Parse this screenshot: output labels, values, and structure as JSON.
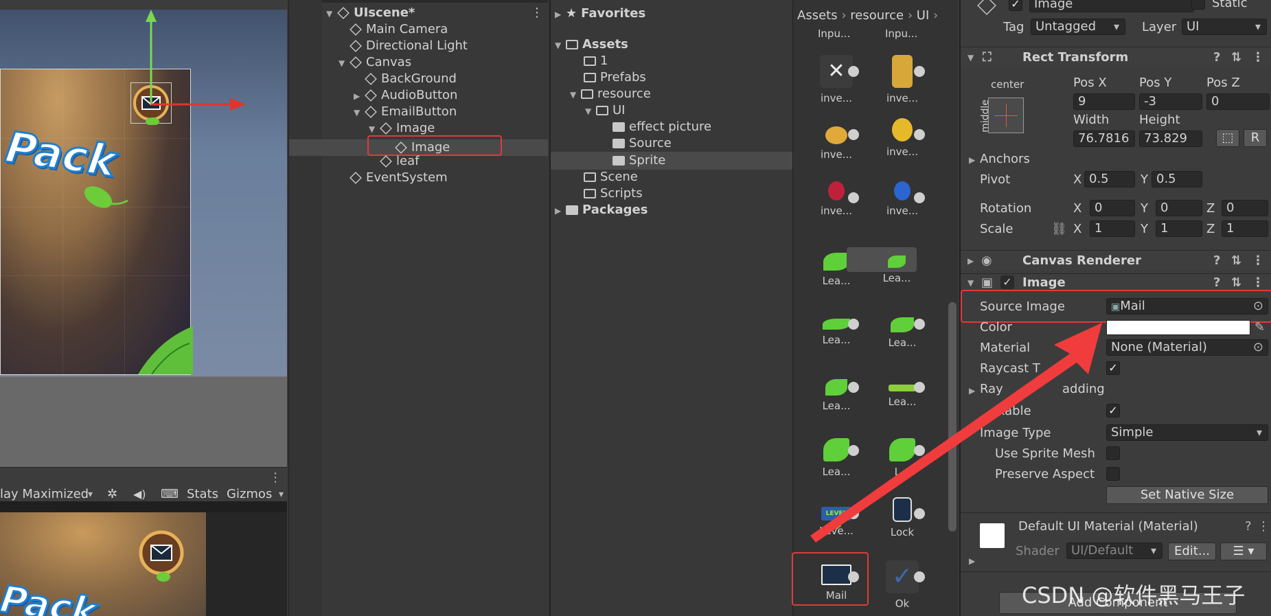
{
  "scene": {
    "pack_text": "Pack"
  },
  "gamebar": {
    "display": "lay Maximized",
    "stats": "Stats",
    "gizmos": "Gizmos"
  },
  "hierarchy": {
    "items": [
      {
        "label": "UIscene*"
      },
      {
        "label": "Main Camera"
      },
      {
        "label": "Directional Light"
      },
      {
        "label": "Canvas"
      },
      {
        "label": "BackGround"
      },
      {
        "label": "AudioButton"
      },
      {
        "label": "EmailButton"
      },
      {
        "label": "Image"
      },
      {
        "label": "Image"
      },
      {
        "label": "leaf"
      },
      {
        "label": "EventSystem"
      }
    ]
  },
  "project": {
    "favorites": "Favorites",
    "assets": "Assets",
    "folders": [
      "1",
      "Prefabs",
      "resource",
      "UI",
      "effect picture",
      "Source",
      "Sprite",
      "Scene",
      "Scripts"
    ],
    "packages": "Packages",
    "breadcrumb": [
      "Assets",
      "resource",
      "UI"
    ],
    "grid_labels": [
      "Inpu...",
      "Inpu...",
      "inve...",
      "inve...",
      "inve...",
      "inve...",
      "inve...",
      "inve...",
      "Lea...",
      "Lea...",
      "Lea...",
      "Lea...",
      "Lea...",
      "Lea...",
      "Lea...",
      "L...",
      "Leve...",
      "Lock",
      "Mail",
      "Ok"
    ]
  },
  "inspector": {
    "name": "Image",
    "static": "Static",
    "tag_label": "Tag",
    "tag_value": "Untagged",
    "layer_label": "Layer",
    "layer_value": "UI",
    "rect_transform": "Rect Transform",
    "anchor_center": "center",
    "anchor_middle": "middle",
    "pos_x_label": "Pos X",
    "pos_y_label": "Pos Y",
    "pos_z_label": "Pos Z",
    "pos_x": "9",
    "pos_y": "-3",
    "pos_z": "0",
    "width_label": "Width",
    "height_label": "Height",
    "width": "76.7816",
    "height": "73.829",
    "anchors": "Anchors",
    "pivot": "Pivot",
    "pivot_x": "0.5",
    "pivot_y": "0.5",
    "rotation": "Rotation",
    "rot_x": "0",
    "rot_y": "0",
    "rot_z": "0",
    "scale": "Scale",
    "scale_x": "1",
    "scale_y": "1",
    "scale_z": "1",
    "x": "X",
    "y": "Y",
    "z": "Z",
    "canvas_renderer": "Canvas Renderer",
    "image_component": "Image",
    "source_image_label": "Source Image",
    "source_image_value": "Mail",
    "color_label": "Color",
    "material_label": "Material",
    "material_value": "None (Material)",
    "raycast_target": "Raycast T",
    "raycast_padding": "Ray",
    "raycast_padding_tail": "adding",
    "maskable": "kable",
    "image_type_label": "Image Type",
    "image_type_value": "Simple",
    "use_sprite_mesh": "Use Sprite Mesh",
    "preserve_aspect": "Preserve Aspect",
    "set_native_size": "Set Native Size",
    "default_material": "Default UI Material (Material)",
    "shader_label": "Shader",
    "shader_value": "UI/Default",
    "edit": "Edit...",
    "add_component": "Add Component"
  },
  "watermark": "CSDN @软件黑马王子",
  "colors": {
    "accent_red": "#e23a3a",
    "selection": "#4a4a4a"
  }
}
